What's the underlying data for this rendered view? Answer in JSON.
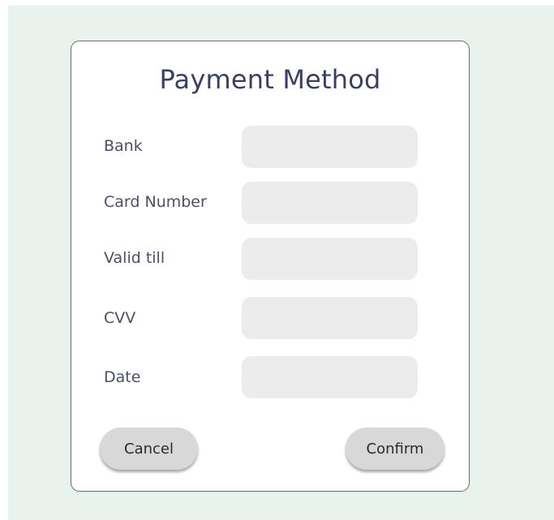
{
  "dialog": {
    "title": "Payment Method",
    "fields": [
      {
        "label": "Bank",
        "value": "",
        "placeholder": ""
      },
      {
        "label": "Card Number",
        "value": "",
        "placeholder": ""
      },
      {
        "label": "Valid till",
        "value": "",
        "placeholder": ""
      },
      {
        "label": "CVV",
        "value": "",
        "placeholder": ""
      },
      {
        "label": "Date",
        "value": "",
        "placeholder": ""
      }
    ],
    "buttons": {
      "cancel_label": "Cancel",
      "confirm_label": "Confirm"
    }
  },
  "colors": {
    "backdrop": "#e8f3ee",
    "title": "#3a3f63",
    "field_bg": "#ececec",
    "button_bg": "#d8d8d8"
  }
}
